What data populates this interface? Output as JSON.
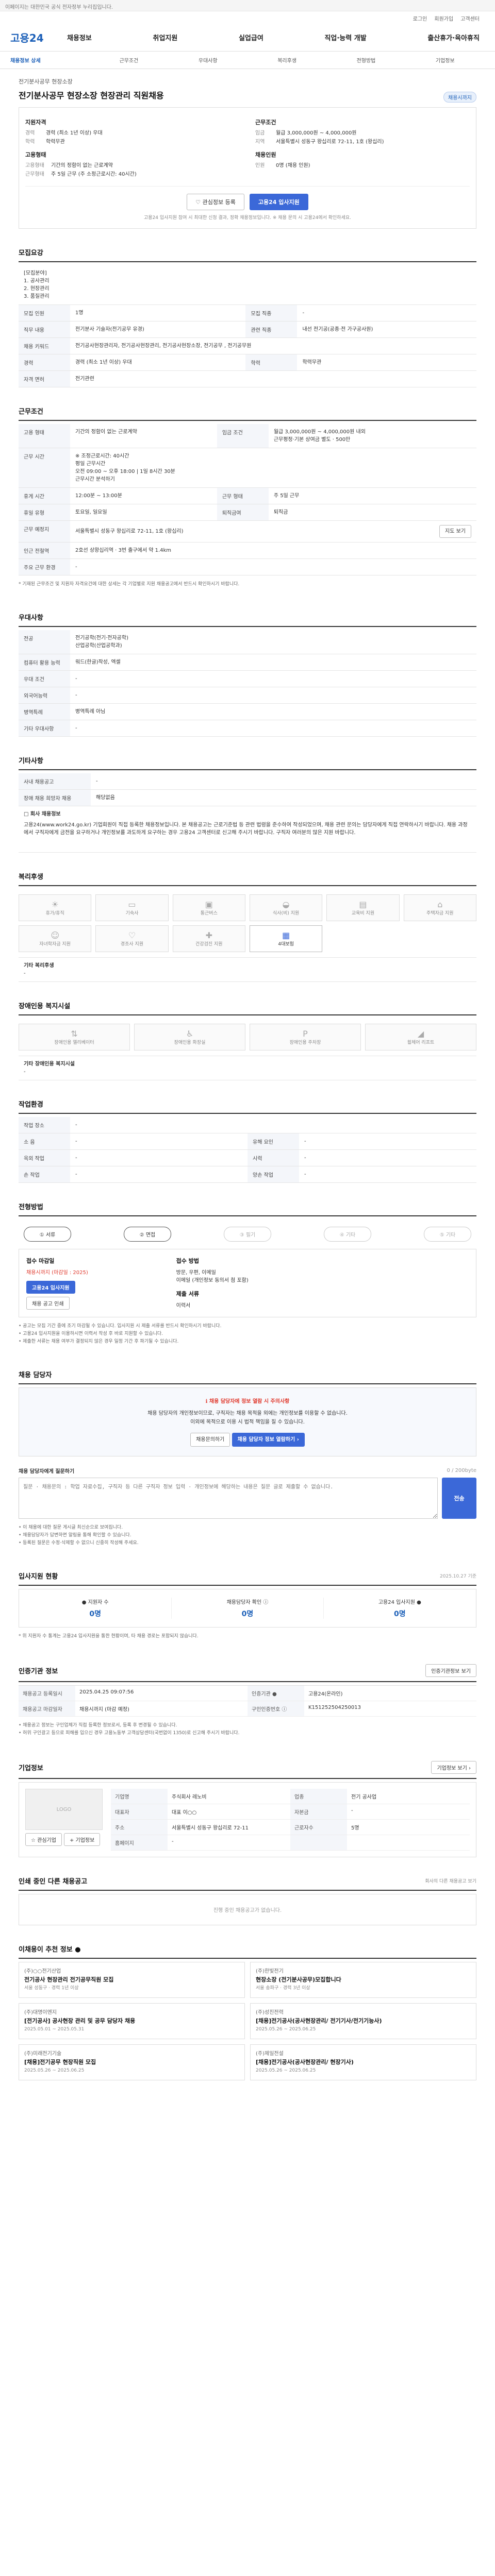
{
  "topbar": {
    "notice": "이페이지는 대한민국 공식 전자정부 누리집입니다."
  },
  "util": {
    "login": "로그인",
    "join": "회원가입",
    "cs": "고객센터"
  },
  "gnb": {
    "logo": "고용24",
    "menu": [
      "채용정보",
      "취업지원",
      "실업급여",
      "직업·능력 개발",
      "출산휴가·육아휴직"
    ]
  },
  "lnb": [
    "채용정보 상세",
    "근무조건",
    "우대사항",
    "복리후생",
    "전형방법",
    "기업정보"
  ],
  "header": {
    "corp": "전기분사공무 현장소장",
    "title": "전기분사공무 현장소장 현장관리 직원채용",
    "status": "채용시까지"
  },
  "summary": {
    "left_title": "지원자격",
    "left_rows": [
      {
        "k": "경력",
        "v": "경력 (최소 1년 이상) 우대"
      },
      {
        "k": "학력",
        "v": "학력무관"
      }
    ],
    "left2_title": "고용형태",
    "left2_rows": [
      {
        "k": "고용형태",
        "v": "기간의 정함이 없는 근로계약"
      },
      {
        "k": "근무형태",
        "v": "주 5일 근무 (주 소정근로시간: 40시간)"
      }
    ],
    "right_title": "근무조건",
    "right_rows": [
      {
        "k": "임금",
        "v": "월급 3,000,000원 ~ 4,000,000원"
      },
      {
        "k": "지역",
        "v": "서울특별시 성동구 왕십리로 72-11, 1호 (왕십리)"
      }
    ],
    "right2_title": "채용인원",
    "right2_rows": [
      {
        "k": "인원",
        "v": "0명 (채용 인원)"
      }
    ],
    "btn_scrap": "♡ 관심정보 등록",
    "btn_apply": "고용24 입사지원",
    "note": "고용24 입사지원 참여 시 최대한 신청 결과, 정확 채용정보입니다. ※ 채용 문의 시 고용24에서 확인하세요."
  },
  "duty": {
    "title": "모집요강",
    "intro_lines": [
      "[모집분야]",
      "1. 공사관리",
      "2. 현장관리",
      "3. 품질관리"
    ],
    "rows": [
      {
        "k": "모집 인원",
        "v": "1명",
        "k2": "모집 직종",
        "v2": "-"
      },
      {
        "k": "직무 내용",
        "v": "전기분사 기술자(전기공무 유경)",
        "k2": "관련 직종",
        "v2": "내선 전기공(공종·전 가구공사원)"
      },
      {
        "k": "채용 키워드",
        "v": "전기공사현장관리자, 전기공사현장관리, 전기공사현장소장, 전기공무 , 전기공무원",
        "k2": "",
        "v2": ""
      },
      {
        "k": "경력",
        "v": "경력 (최소 1년 이상) 우대",
        "k2": "학력",
        "v2": "학력무관"
      },
      {
        "k": "자격 면허",
        "v": "전기관련",
        "k2": "",
        "v2": ""
      }
    ]
  },
  "work": {
    "title": "근무조건",
    "rows": [
      {
        "k": "고용 형태",
        "v": "기간의 정함이 없는 근로계약",
        "k2": "임금 조건",
        "v2": "월급 3,000,000원 ~ 4,000,000원 내외\n근무평정·기본 상여금 별도 · 500만"
      },
      {
        "k": "근무 시간",
        "v": "※ 조정근로시간: 40시간\n평일 근무시간\n오전 09:00 ~ 오후 18:00 | 1일 8시간 30분\n근무시간 분석하기",
        "k2": "",
        "v2": ""
      },
      {
        "k": "휴게 시간",
        "v": "12:00분 ~ 13:00분",
        "k2": "근무 형태",
        "v2": "주 5일 근무"
      },
      {
        "k": "휴일 유형",
        "v": "토요일, 일요일",
        "k2": "퇴직금여",
        "v2": "퇴직금"
      },
      {
        "k": "근무 예정지",
        "v": "서울특별시 성동구 왕십리로 72-11, 1호 (왕십리)",
        "k2": "",
        "v2": ""
      },
      {
        "k": "인근 전철역",
        "v": "2호선 상왕십리역 · 3번 출구에서 약 1.4km",
        "k2": "",
        "v2": ""
      },
      {
        "k": "주요 근무 환경",
        "v": "-",
        "k2": "",
        "v2": ""
      }
    ],
    "map_btn": "지도 보기",
    "note": "* 기재된 근무조건 및 지원자 자격요건에 대한 상세는 각 기업별로 지원 채용공고에서 반드시 확인하시기 바랍니다."
  },
  "prefer": {
    "title": "우대사항",
    "rows": [
      {
        "k": "전공",
        "v": "전기공학(전기·전자공학)\n산업공학(산업공학과)"
      },
      {
        "k": "컴퓨터 활용 능력",
        "v": "워드(한글)작성, 엑셀"
      },
      {
        "k": "우대 조건",
        "v": "-"
      },
      {
        "k": "외국어능력",
        "v": "-"
      },
      {
        "k": "병역특례",
        "v": "병역특례 아님"
      },
      {
        "k": "기타 우대사항",
        "v": "-"
      }
    ]
  },
  "etc": {
    "title": "기타사항",
    "rows": [
      {
        "k": "사내 채용공고",
        "v": "-"
      },
      {
        "k": "장애 채용 희망자 채용",
        "v": "해당없음"
      }
    ],
    "detail_title": "□ 회사 채용정보",
    "detail_text": "고용24(www.work24.go.kr) 기업회원이 직접 등록한 채용정보입니다. 본 채용공고는 근로기준법 등 관련 법령을 준수하여 작성되었으며, 채용 관련 문의는 담당자에게 직접 연락하시기 바랍니다. 채용 과정에서 구직자에게 금전을 요구하거나 개인정보를 과도하게 요구하는 경우 고용24 고객센터로 신고해 주시기 바랍니다. 구직자 여러분의 많은 지원 바랍니다."
  },
  "welfare": {
    "title": "복리후생",
    "items": [
      {
        "icon": "sun-icon",
        "glyph": "☀",
        "label": "휴가/휴직",
        "on": false
      },
      {
        "icon": "bed-icon",
        "glyph": "▭",
        "label": "기숙사",
        "on": false
      },
      {
        "icon": "bus-icon",
        "glyph": "▣",
        "label": "통근버스",
        "on": false
      },
      {
        "icon": "meal-icon",
        "glyph": "◒",
        "label": "식사(비) 지원",
        "on": false
      },
      {
        "icon": "book-icon",
        "glyph": "▤",
        "label": "교육비 지원",
        "on": false
      },
      {
        "icon": "house-icon",
        "glyph": "⌂",
        "label": "주택자금 지원",
        "on": false
      },
      {
        "icon": "child-icon",
        "glyph": "☺",
        "label": "자녀학자금 지원",
        "on": false
      },
      {
        "icon": "heart-icon",
        "glyph": "♡",
        "label": "경조사 지원",
        "on": false
      },
      {
        "icon": "gift-icon",
        "glyph": "✚",
        "label": "건강검진 지원",
        "on": false
      },
      {
        "icon": "insurance-icon",
        "glyph": "▦",
        "label": "4대보험",
        "on": true
      }
    ],
    "etc_label": "기타 복리후생",
    "etc_value": "-"
  },
  "disabled": {
    "title": "장애인용 복지시설",
    "items": [
      {
        "icon": "elevator-icon",
        "glyph": "⇅",
        "label": "장애인용 엘리베이터"
      },
      {
        "icon": "toilet-icon",
        "glyph": "♿",
        "label": "장애인용 화장실"
      },
      {
        "icon": "parking-icon",
        "glyph": "P",
        "label": "장애인용 주차장"
      },
      {
        "icon": "ramp-icon",
        "glyph": "◢",
        "label": "휠체어 리프트"
      }
    ],
    "etc_label": "기타 장애인용 복지시설",
    "etc_value": "-"
  },
  "env": {
    "title": "작업환경",
    "rows": [
      {
        "k": "작업 장소",
        "v": "-",
        "k2": "",
        "v2": ""
      },
      {
        "k": "소 음",
        "v": "-",
        "k2": "유해 요인",
        "v2": "-"
      },
      {
        "k": "옥외 작업",
        "v": "-",
        "k2": "시력",
        "v2": "-"
      },
      {
        "k": "손 작업",
        "v": "-",
        "k2": "양손 작업",
        "v2": "-"
      }
    ]
  },
  "process": {
    "title": "전형방법",
    "steps": [
      {
        "label": "① 서류",
        "on": true
      },
      {
        "label": "② 면접",
        "on": true
      },
      {
        "label": "③ 필기",
        "on": false
      },
      {
        "label": "④ 기타",
        "on": false
      },
      {
        "label": "⑤ 기타",
        "on": false
      }
    ]
  },
  "apply": {
    "deadline_label": "접수 마감일",
    "deadline_value": "채용시까지 (마감일 : 2025)",
    "method_label": "접수 방법",
    "method_value": "방문, 우편, 이메일\n이메일 (개인정보 동의서 첨 포함)",
    "btn_apply": "고용24 입사지원",
    "btn_print": "채용 공고 인쇄",
    "docs_label": "제출 서류",
    "docs_value": "이력서",
    "bullets": [
      "• 공고는 모집 기간 중에 조기 마감될 수 있습니다. 입사지원 시 제출 서류를 반드시 확인하시기 바랍니다.",
      "• 고용24 입사지원을 이용하시면 이력서 작성 후 바로 지원할 수 있습니다.",
      "• 제출한 서류는 채용 여부가 결정되지 않은 경우 일정 기간 후 파기될 수 있습니다."
    ]
  },
  "manager": {
    "title": "채용 담당자",
    "notice_title": "ℹ 채용 담당자에 정보 열람 시 주의사항",
    "notice_text": "채용 담당자의 개인정보이므로, 구직자는 채용 목적을 외에는 개인정보를 이용할 수 없습니다.\n이외에 목적으로 이용 시 법적 책임을 질 수 있습니다.",
    "btn_view": "채용 담당자 정보 열람하기 ›",
    "btn_inquiry": "채용문의하기",
    "qa_title": "채용 담당자에게 질문하기",
    "qa_counter": "0 / 200byte",
    "qa_placeholder": "질문 · 채용문의 : 학업 자료수집, 구직자 등 다른 구직자 정보 입력 · 개인정보에 해당하는 내용은 질문 글로 제출할 수 없습니다.",
    "qa_btn": "전송",
    "qa_notes": [
      "• 이 채용에 대한 질문 게시글 최신순으로 보여집니다.",
      "• 채용담당자가 답변하면 알림을 통해 확인할 수 있습니다.",
      "• 등록된 질문은 수정·삭제할 수 없으니 신중히 작성해 주세요."
    ]
  },
  "status_sec": {
    "title": "입사지원 현황",
    "updated": "2025.10.27 기준",
    "items": [
      {
        "label": "● 지원자 수",
        "value": "0명"
      },
      {
        "label": "채용담당자 확인 ⓘ",
        "value": "0명"
      },
      {
        "label": "고용24 입사지원 ●",
        "value": "0명"
      }
    ],
    "note": "* 위 지원자 수 통계는 고용24 입사지원을 통한 현황이며, 타 채용 경로는 포함되지 않습니다."
  },
  "info": {
    "title": "인증기관 정보",
    "btn": "인증기관정보 보기",
    "rows": [
      {
        "k": "채용공고 등록일시",
        "v": "2025.04.25 09:07:56",
        "k2": "인증기관 ●",
        "v2": "고용24(온라인)"
      },
      {
        "k": "채용공고 마감일자",
        "v": "채용시까지 (마감 예정)",
        "k2": "구인인증번호 ⓘ",
        "v2": "K151252504250013"
      }
    ],
    "notes": [
      "• 채용공고 정보는 구인업체가 직접 등록한 정보로서, 등록 후 변경될 수 있습니다.",
      "• 허위 구인광고 등으로 피해를 입으신 경우 고용노동부 고객상담센터(국번없이 1350)로 신고해 주시기 바랍니다."
    ]
  },
  "corp": {
    "title": "기업정보",
    "btn": "기업정보 보기 ›",
    "logo_text": "LOGO",
    "btn_scrap": "☆ 관심기업",
    "btn_follow": "+ 기업정보",
    "rows": [
      {
        "k": "기업명",
        "v": "주식회사 레노비",
        "k2": "업종",
        "v2": "전기 공사업"
      },
      {
        "k": "대표자",
        "v": "대표 이○○",
        "k2": "자본금",
        "v2": "-"
      },
      {
        "k": "주소",
        "v": "서울특별시 성동구 왕십리로 72-11",
        "k2": "근로자수",
        "v2": "5명"
      },
      {
        "k": "홈페이지",
        "v": "-",
        "k2": "",
        "v2": ""
      }
    ]
  },
  "other": {
    "title": "인쇄 중인 다른 채용공고",
    "more": "회사의 다른 채용공고 보기",
    "empty": "진행 중인 채용공고가 없습니다."
  },
  "recommend": {
    "title": "이채용이 추천 정보 ●",
    "cards": [
      {
        "co": "(주)○○전기산업",
        "ti": "전기공사 현장관리 전기공무직원 모집",
        "me": "서울 성동구 · 경력 1년 이상"
      },
      {
        "co": "(주)한빛전기",
        "ti": "현장소장 (전기분사공무)모집합니다",
        "me": "서울 송파구 · 경력 3년 이상"
      },
      {
        "co": "(주)대명이엔지",
        "ti": "[전기공사] 공사현장 관리 및 공무 담당자 채용",
        "me": "2025.05.01 ~ 2025.05.31"
      },
      {
        "co": "(주)성진전력",
        "ti": "[채용]전기공사(공사현장관리/ 전기기사/전기기능사)",
        "me": "2025.05.26 ~ 2025.06.25"
      },
      {
        "co": "(주)미래전기기술",
        "ti": "[채용]전기공무 현장직원 모집",
        "me": "2025.05.26 ~ 2025.06.25"
      },
      {
        "co": "(주)제일전설",
        "ti": "[채용]전기공사(공사현장관리/ 현장기사)",
        "me": "2025.05.26 ~ 2025.06.25"
      }
    ]
  }
}
